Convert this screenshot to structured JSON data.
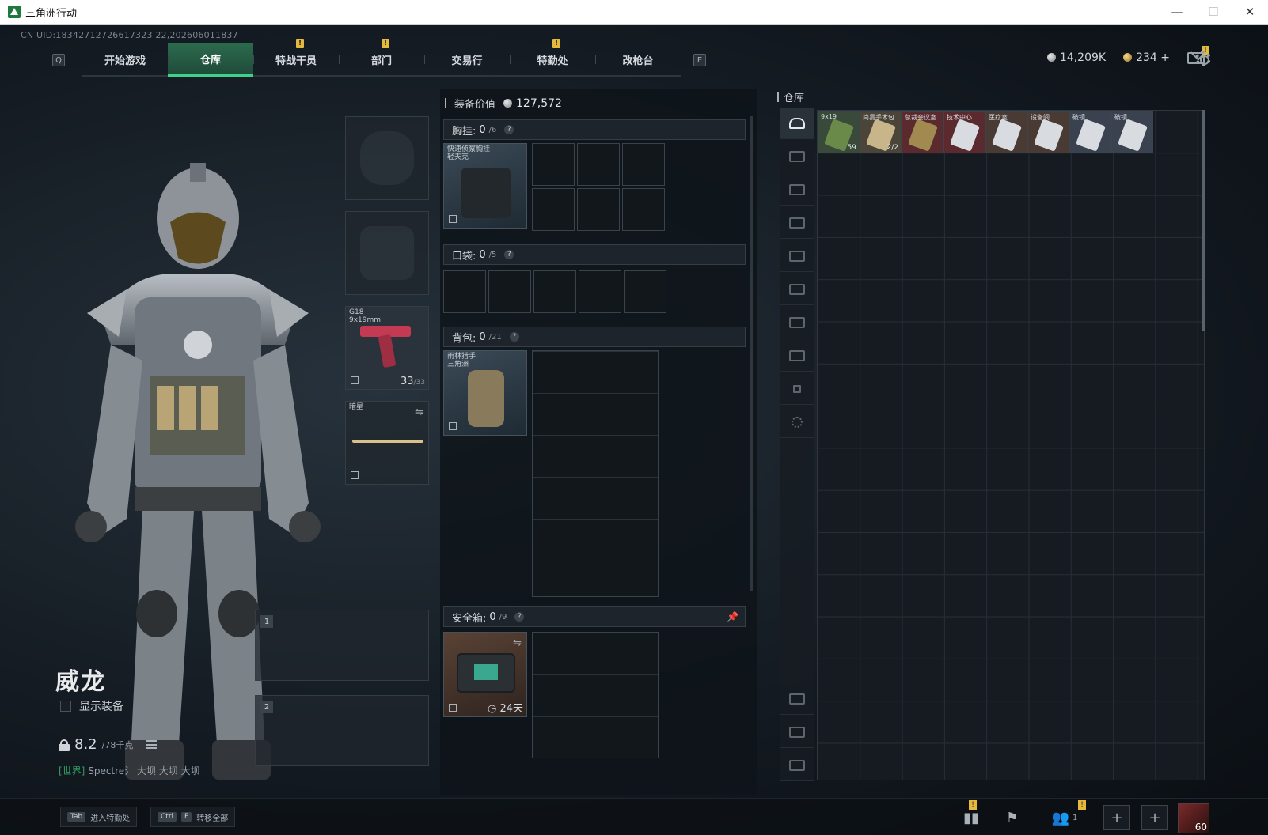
{
  "window": {
    "title": "三角洲行动",
    "controls": {
      "minimize": "—",
      "maximize": "☐",
      "close": "✕"
    }
  },
  "uid": "CN UID:18342712726617323 22,202606011837",
  "nav": {
    "key_left": "Q",
    "key_right": "E",
    "tabs": [
      {
        "label": "开始游戏",
        "notif": ""
      },
      {
        "label": "仓库",
        "notif": ""
      },
      {
        "label": "特战干员",
        "notif": "!"
      },
      {
        "label": "部门",
        "notif": "!"
      },
      {
        "label": "交易行",
        "notif": ""
      },
      {
        "label": "特勤处",
        "notif": "!"
      },
      {
        "label": "改枪台",
        "notif": ""
      }
    ],
    "active_tab": 1
  },
  "currency": {
    "silver": "14,209K",
    "gold": "234",
    "gold_add": "+",
    "mail_notif": "!"
  },
  "character": {
    "name": "威龙",
    "show_gear_label": "显示装备",
    "weight_main": "8.2",
    "weight_sub": "/78千克",
    "chat_channel": "[世界]",
    "chat_text": "Spectre氵 大坝 大坝 大坝"
  },
  "equip_slots": {
    "pistol": {
      "label1": "G18",
      "label2": "9x19mm",
      "ammo": "33",
      "ammo_max": "/33"
    },
    "melee": {
      "label": "暗星",
      "swap": "⇋"
    },
    "weapon1": {
      "num": "1"
    },
    "weapon2": {
      "num": "2"
    }
  },
  "equipment": {
    "value_label": "装备价值",
    "value": "127,572",
    "chest": {
      "label": "胸挂:",
      "count": "0",
      "max": "/6",
      "item": "快速侦察胸挂",
      "item2": "轻夫克"
    },
    "pocket": {
      "label": "口袋:",
      "count": "0",
      "max": "/5"
    },
    "backpack": {
      "label": "背包:",
      "count": "0",
      "max": "/21",
      "item": "雨林猎手",
      "item2": "三角洲"
    },
    "safe": {
      "label": "安全箱:",
      "count": "0",
      "max": "/9",
      "time": "24天",
      "pin": "📌",
      "swap": "⇋"
    },
    "help": "?"
  },
  "warehouse": {
    "title": "仓库",
    "items": [
      {
        "label": "9x19",
        "qty": "59",
        "color": "#3a4a3a",
        "art": "#6a8a4a"
      },
      {
        "label": "简易手术包",
        "qty": "2/2",
        "color": "#4a4538",
        "art": "#c8b58a"
      },
      {
        "label": "总裁会议室",
        "qty": "",
        "color": "#5a2a2e",
        "art": "#a08a50"
      },
      {
        "label": "技术中心",
        "qty": "",
        "color": "#5a2a2e",
        "art": "#d8dce0"
      },
      {
        "label": "医疗室",
        "qty": "",
        "color": "#4a3a34",
        "art": "#d8dce0"
      },
      {
        "label": "设备间",
        "qty": "",
        "color": "#4a3a34",
        "art": "#d8dce0"
      },
      {
        "label": "破镜",
        "qty": "",
        "color": "#3a4250",
        "art": "#d8dce0"
      },
      {
        "label": "破镜",
        "qty": "",
        "color": "#3a4250",
        "art": "#d8dce0"
      }
    ]
  },
  "bottom": {
    "hint1_key": "Tab",
    "hint1_label": "进入特勤处",
    "hint2_key1": "Ctrl",
    "hint2_key2": "F",
    "hint2_label": "转移全部",
    "notif": "!",
    "friends_count": "1",
    "add": "+",
    "level": "60"
  }
}
